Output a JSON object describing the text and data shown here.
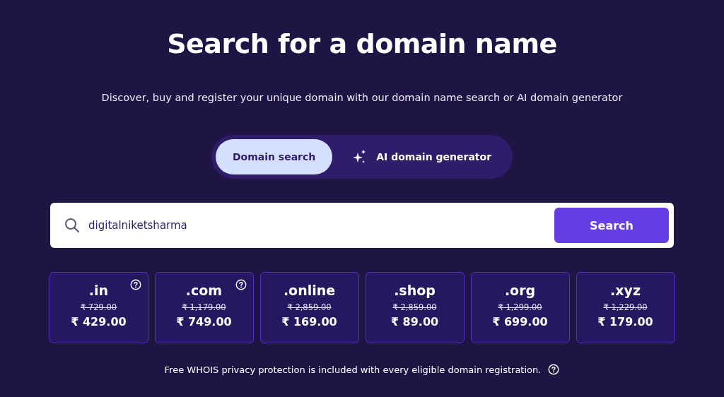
{
  "title": "Search for a domain name",
  "subtitle": "Discover, buy and register your unique domain with our domain name search or AI domain generator",
  "tabs": [
    {
      "label": "Domain search",
      "selected": true,
      "kind": "plain"
    },
    {
      "label": "AI domain generator",
      "selected": false,
      "kind": "sparkle"
    }
  ],
  "search": {
    "value": "digitalniketsharma",
    "button": "Search"
  },
  "domains": [
    {
      "tld": ".in",
      "old_price": "₹ 729.00",
      "price": "₹ 429.00",
      "help": true
    },
    {
      "tld": ".com",
      "old_price": "₹ 1,179.00",
      "price": "₹ 749.00",
      "help": true
    },
    {
      "tld": ".online",
      "old_price": "₹ 2,859.00",
      "price": "₹ 169.00",
      "help": false
    },
    {
      "tld": ".shop",
      "old_price": "₹ 2,859.00",
      "price": "₹ 89.00",
      "help": false
    },
    {
      "tld": ".org",
      "old_price": "₹ 1,299.00",
      "price": "₹ 699.00",
      "help": false
    },
    {
      "tld": ".xyz",
      "old_price": "₹ 1,229.00",
      "price": "₹ 179.00",
      "help": false
    }
  ],
  "footer": "Free WHOIS privacy protection is included with every eligible domain registration."
}
